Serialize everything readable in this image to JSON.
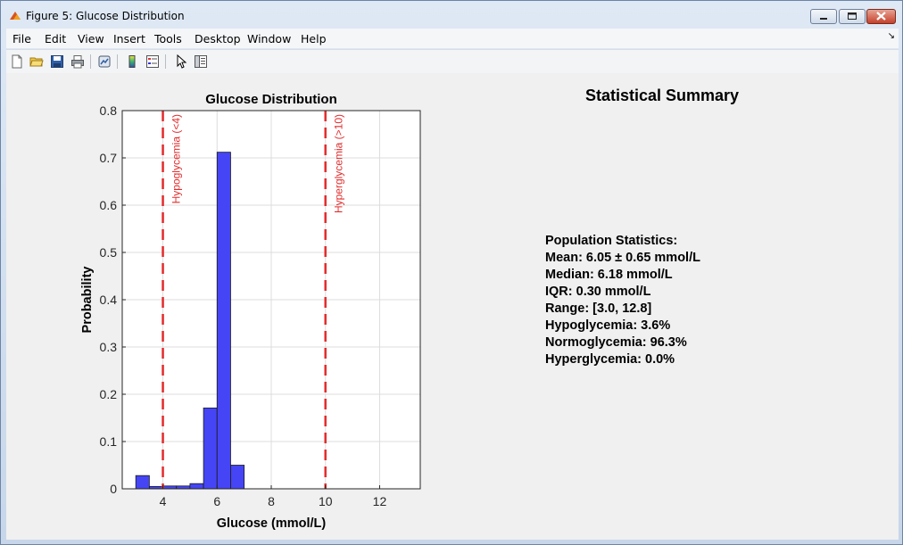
{
  "window": {
    "title": "Figure 5: Glucose Distribution",
    "icon": "matlab-figure-icon"
  },
  "menu": [
    "File",
    "Edit",
    "View",
    "Insert",
    "Tools",
    "Desktop",
    "Window",
    "Help"
  ],
  "toolbar_icons": [
    "new-figure-icon",
    "open-file-icon",
    "save-icon",
    "print-icon",
    "link-plot-icon",
    "colorbar-icon",
    "legend-icon",
    "pointer-icon",
    "property-editor-icon"
  ],
  "colors": {
    "bar": "#4545f5",
    "threshold": "#e32b2b"
  },
  "summary": {
    "title": "Statistical Summary",
    "lines": [
      "Population Statistics:",
      "Mean: 6.05 ± 0.65 mmol/L",
      "Median: 6.18 mmol/L",
      "IQR: 0.30 mmol/L",
      "Range: [3.0, 12.8]",
      "Hypoglycemia: 3.6%",
      "Normoglycemia: 96.3%",
      "Hyperglycemia: 0.0%"
    ]
  },
  "chart_data": {
    "type": "bar",
    "title": "Glucose Distribution",
    "xlabel": "Glucose (mmol/L)",
    "ylabel": "Probability",
    "xlim": [
      2.5,
      13.5
    ],
    "ylim": [
      0,
      0.8
    ],
    "xticks": [
      4,
      6,
      8,
      10,
      12
    ],
    "yticks": [
      0,
      0.1,
      0.2,
      0.3,
      0.4,
      0.5,
      0.6,
      0.7,
      0.8
    ],
    "grid": true,
    "bins": [
      {
        "x0": 3.0,
        "x1": 3.5,
        "value": 0.028
      },
      {
        "x0": 3.5,
        "x1": 4.0,
        "value": 0.005
      },
      {
        "x0": 4.0,
        "x1": 4.5,
        "value": 0.006
      },
      {
        "x0": 4.5,
        "x1": 5.0,
        "value": 0.006
      },
      {
        "x0": 5.0,
        "x1": 5.5,
        "value": 0.011
      },
      {
        "x0": 5.5,
        "x1": 6.0,
        "value": 0.171
      },
      {
        "x0": 6.0,
        "x1": 6.5,
        "value": 0.712
      },
      {
        "x0": 6.5,
        "x1": 7.0,
        "value": 0.05
      }
    ],
    "thresholds": [
      {
        "x": 4,
        "label": "Hypoglycemia (<4)"
      },
      {
        "x": 10,
        "label": "Hyperglycemia (>10)"
      }
    ]
  }
}
